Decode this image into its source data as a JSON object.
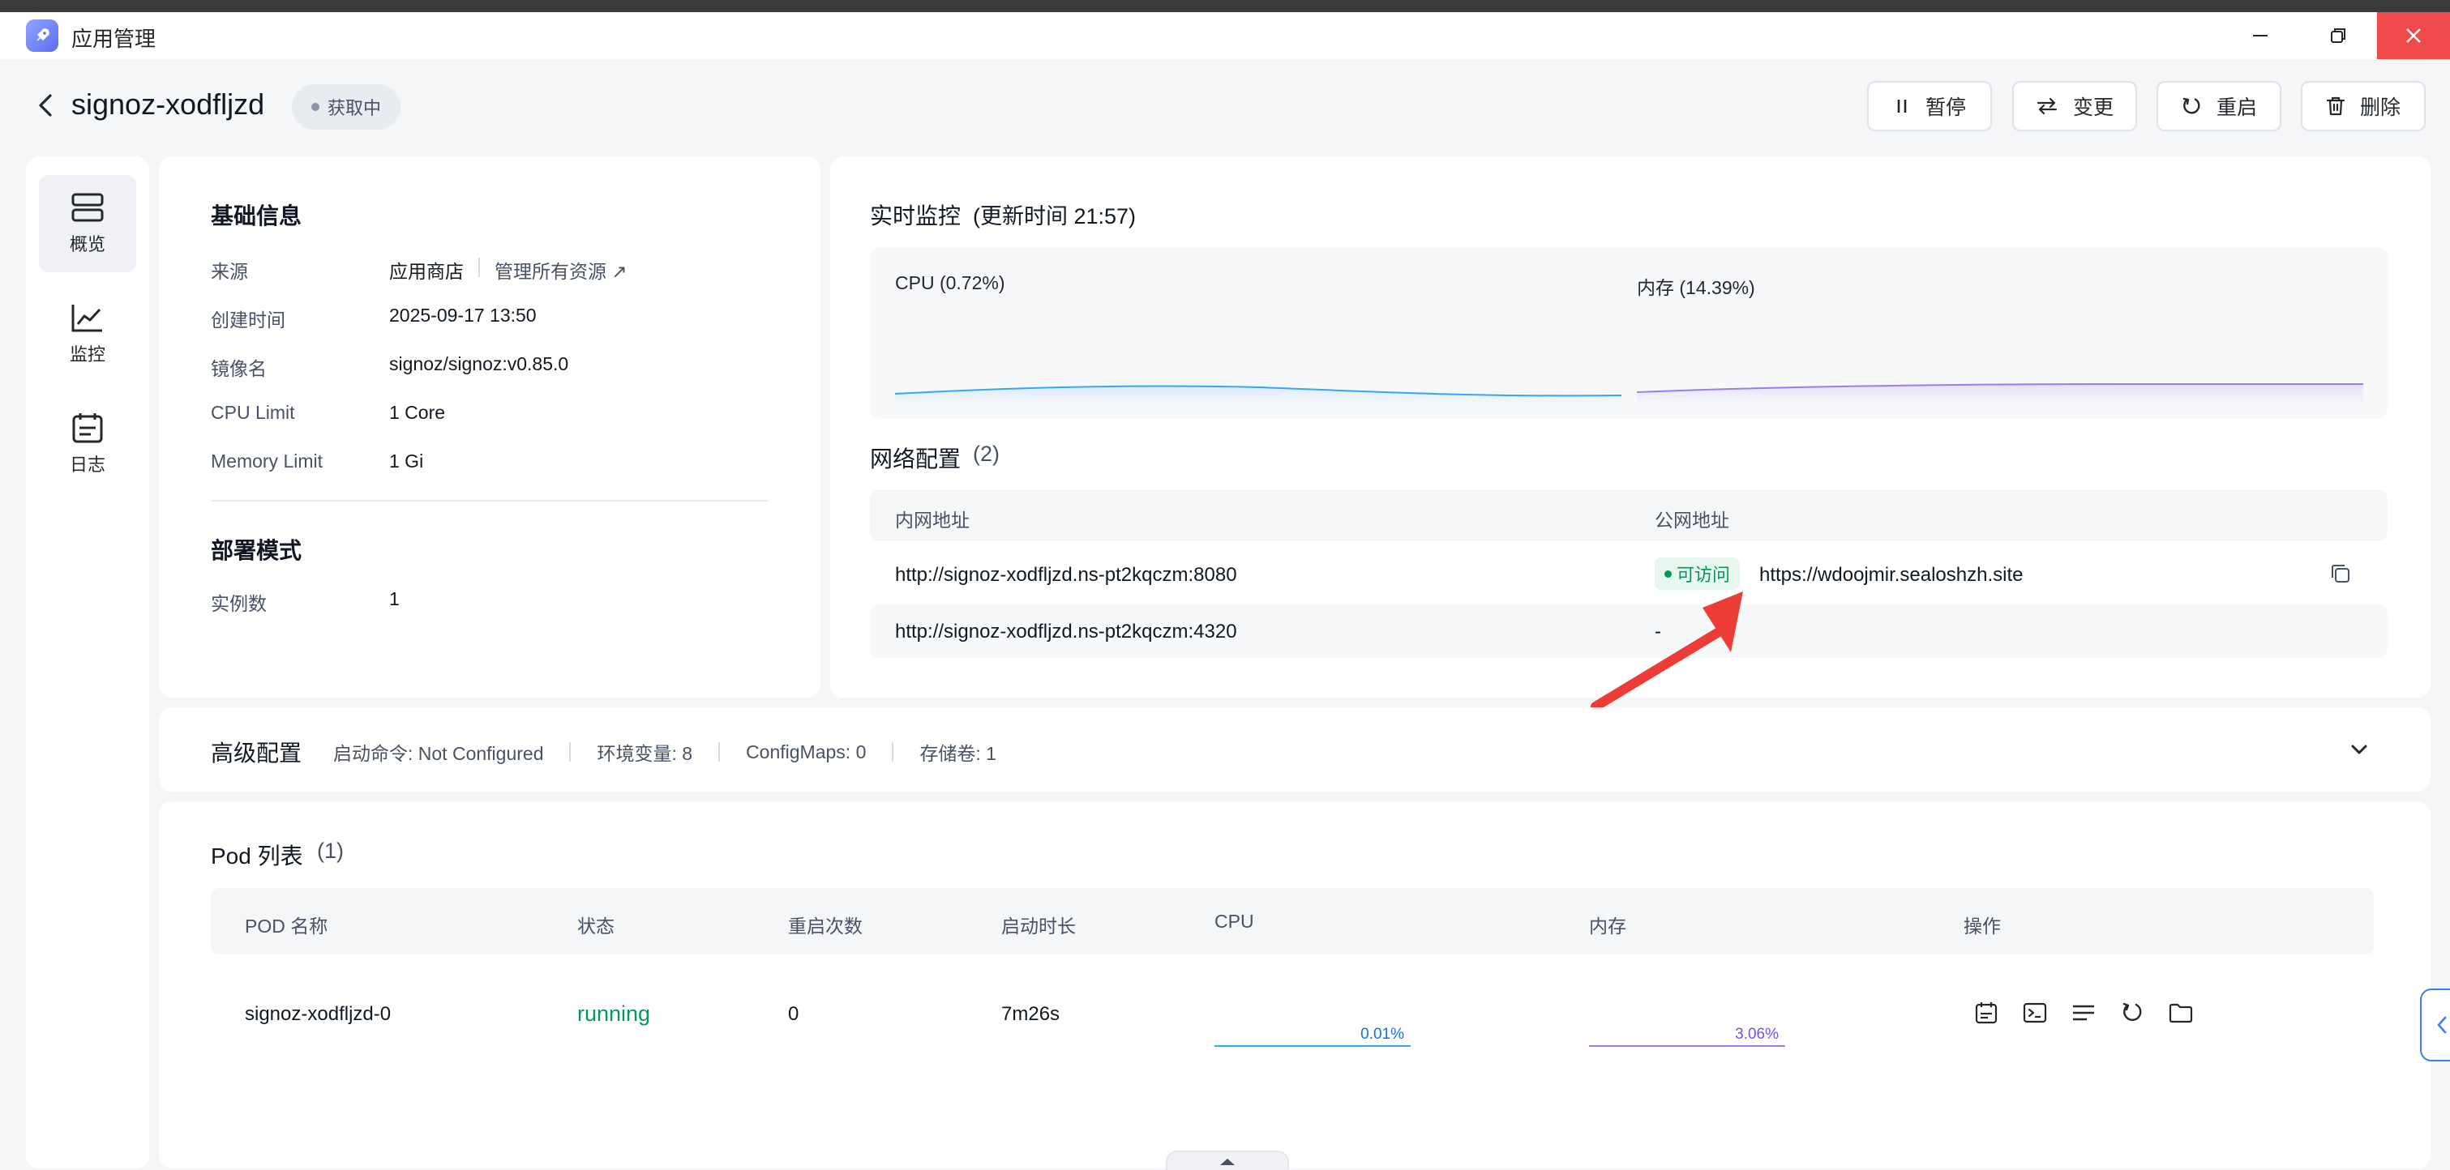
{
  "window": {
    "app_title": "应用管理",
    "controls": [
      "minimize-icon",
      "restore-icon",
      "close-icon"
    ],
    "close_color": "#f04a4a"
  },
  "header": {
    "app_name": "signoz-xodfljzd",
    "status": "获取中",
    "actions": [
      {
        "label": "暂停",
        "icon": "pause-icon"
      },
      {
        "label": "变更",
        "icon": "swap-icon"
      },
      {
        "label": "重启",
        "icon": "restart-icon"
      },
      {
        "label": "删除",
        "icon": "trash-icon"
      }
    ]
  },
  "sidebar": {
    "items": [
      {
        "label": "概览",
        "icon": "server-icon",
        "active": true
      },
      {
        "label": "监控",
        "icon": "chart-line-icon",
        "active": false
      },
      {
        "label": "日志",
        "icon": "calendar-log-icon",
        "active": false
      }
    ]
  },
  "basic_info": {
    "title": "基础信息",
    "rows": [
      {
        "key": "来源",
        "value": "应用商店",
        "link": "管理所有资源 ↗"
      },
      {
        "key": "创建时间",
        "value": "2025-09-17 13:50"
      },
      {
        "key": "镜像名",
        "value": "signoz/signoz:v0.85.0"
      },
      {
        "key": "CPU Limit",
        "value": "1 Core"
      },
      {
        "key": "Memory Limit",
        "value": "1 Gi"
      }
    ],
    "deploy_title": "部署模式",
    "deploy_rows": [
      {
        "key": "实例数",
        "value": "1"
      }
    ]
  },
  "monitor": {
    "title": "实时监控",
    "updated": "(更新时间  21:57)",
    "cpu_label": "CPU  (0.72%)",
    "mem_label": "内存  (14.39%)",
    "cpu_color": "#36a7f5",
    "mem_color": "#9c7df0"
  },
  "network": {
    "title": "网络配置",
    "count": "(2)",
    "col_internal": "内网地址",
    "col_public": "公网地址",
    "rows": [
      {
        "internal": "http://signoz-xodfljzd.ns-pt2kqczm:8080",
        "badge": "可访问",
        "public": "https://wdoojmir.sealoshzh.site",
        "copy": true
      },
      {
        "internal": "http://signoz-xodfljzd.ns-pt2kqczm:4320",
        "badge": "",
        "public": "-",
        "copy": false
      }
    ],
    "badge_color": "#039855"
  },
  "advanced": {
    "title": "高级配置",
    "items": [
      "启动命令: Not Configured",
      "环境变量: 8",
      "ConfigMaps: 0",
      "存储卷: 1"
    ]
  },
  "pods": {
    "title": "Pod 列表",
    "count": "(1)",
    "columns": [
      "POD 名称",
      "状态",
      "重启次数",
      "启动时长",
      "CPU",
      "内存",
      "操作"
    ],
    "rows": [
      {
        "name": "signoz-xodfljzd-0",
        "status": "running",
        "restarts": "0",
        "uptime": "7m26s",
        "cpu": "0.01%",
        "mem": "3.06%"
      }
    ],
    "row_actions": [
      "detail-calendar-icon",
      "terminal-icon",
      "log-lines-icon",
      "restart-icon",
      "folder-icon"
    ],
    "running_color": "#039855"
  }
}
